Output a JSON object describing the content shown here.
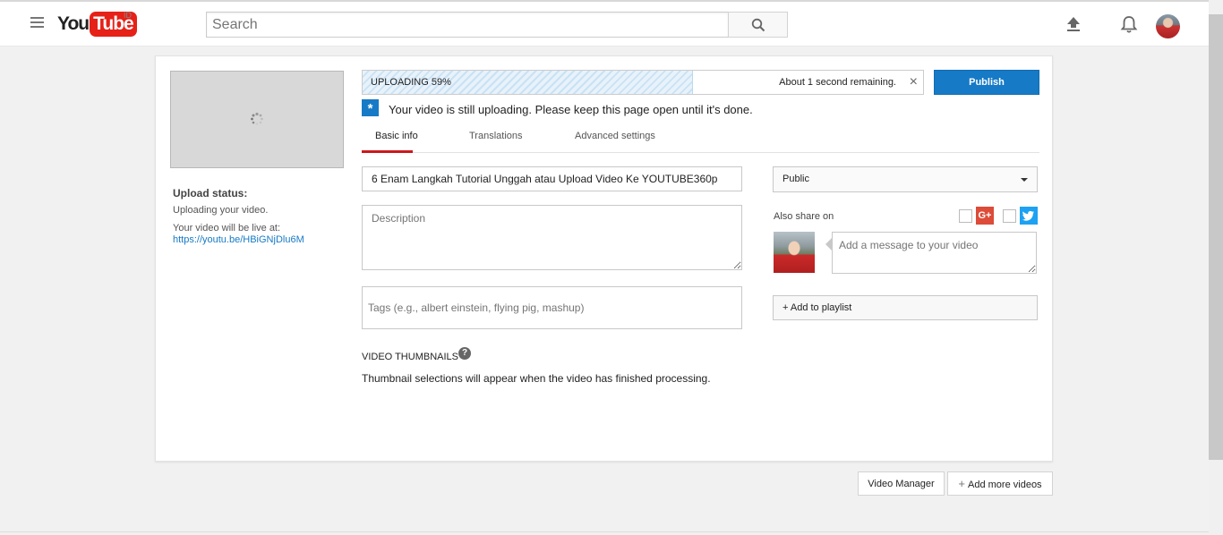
{
  "masthead": {
    "logo_you": "You",
    "logo_tube": "Tube",
    "logo_region": "ID",
    "search_placeholder": "Search"
  },
  "upload": {
    "progress_label": "UPLOADING 59%",
    "progress_fraction": 0.59,
    "time_remaining": "About 1 second remaining.",
    "close_symbol": "×",
    "publish_label": "Publish",
    "notice": "Your video is still uploading. Please keep this page open until it's done.",
    "status_label": "Upload status:",
    "status_text": "Uploading your video.",
    "live_at_text": "Your video will be live at:",
    "live_link": "https://youtu.be/HBiGNjDlu6M"
  },
  "tabs": [
    {
      "label": "Basic info",
      "active": true
    },
    {
      "label": "Translations",
      "active": false
    },
    {
      "label": "Advanced settings",
      "active": false
    }
  ],
  "form": {
    "title_value": "6 Enam Langkah Tutorial Unggah atau Upload Video Ke YOUTUBE360p",
    "description_placeholder": "Description",
    "tags_placeholder": "Tags (e.g., albert einstein, flying pig, mashup)",
    "thumbnails_heading": "VIDEO THUMBNAILS",
    "thumbnails_text": "Thumbnail selections will appear when the video has finished processing."
  },
  "sidebar_right": {
    "privacy_value": "Public",
    "share_label": "Also share on",
    "gplus_label": "G+",
    "message_placeholder": "Add a message to your video",
    "playlist_label": "+ Add to playlist"
  },
  "footer": {
    "video_manager_label": "Video Manager",
    "add_more_label": "Add more videos"
  },
  "colors": {
    "brand_red": "#e62117",
    "accent_blue": "#167ac6",
    "tab_underline": "#cc181e"
  }
}
